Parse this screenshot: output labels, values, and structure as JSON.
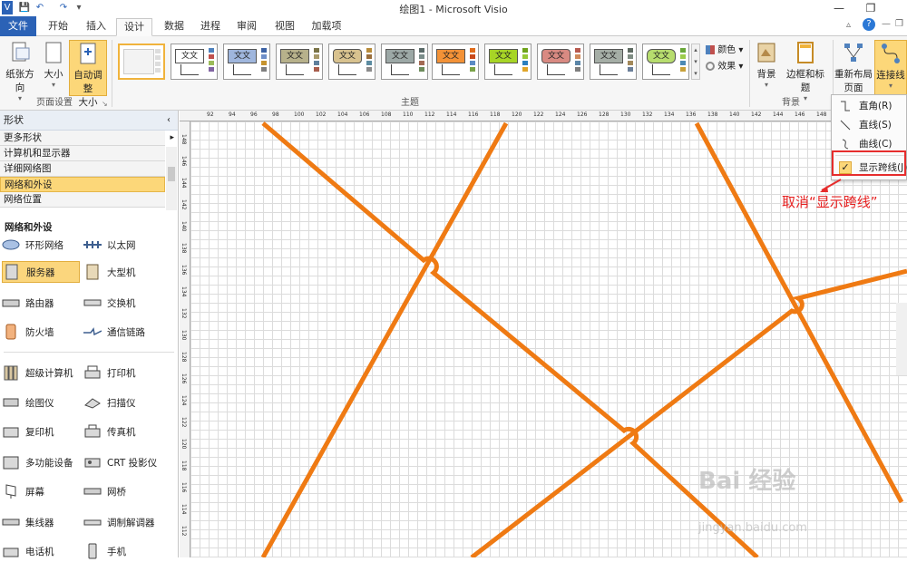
{
  "window": {
    "title": "绘图1 - Microsoft Visio",
    "quick_access": [
      "V",
      "💾",
      "↶",
      "↷",
      "▾"
    ]
  },
  "tabs": [
    "文件",
    "开始",
    "插入",
    "设计",
    "数据",
    "进程",
    "审阅",
    "视图",
    "加载项"
  ],
  "active_tab": "设计",
  "ribbon": {
    "page_setup": {
      "label": "页面设置",
      "buttons": [
        "纸张方向",
        "大小",
        "自动调整",
        "大小"
      ]
    },
    "themes": {
      "label": "主题",
      "tile_text": "文文",
      "colors_label": "颜色",
      "effects_label": "效果"
    },
    "background": {
      "label": "背景",
      "buttons": [
        "背景",
        "边框和标题"
      ]
    },
    "layout": {
      "relayout_label": "重新布局",
      "relayout_sub": "页面",
      "connector_label": "连接线"
    }
  },
  "connector_menu": {
    "items": [
      "直角(R)",
      "直线(S)",
      "曲线(C)",
      "显示跨线(J)"
    ],
    "checked_item": "显示跨线(J)"
  },
  "annotation": "取消“显示跨线”",
  "shapes_panel": {
    "header": "形状",
    "stencils": [
      "更多形状",
      "计算机和显示器",
      "详细网络图",
      "网络和外设",
      "网络位置"
    ],
    "selected_stencil": "网络和外设",
    "section_title": "网络和外设",
    "items": [
      "环形网络",
      "以太网",
      "服务器",
      "大型机",
      "路由器",
      "交换机",
      "防火墙",
      "通信链路",
      "超级计算机",
      "打印机",
      "绘图仪",
      "扫描仪",
      "复印机",
      "传真机",
      "多功能设备",
      "CRT 投影仪",
      "屏幕",
      "网桥",
      "集线器",
      "调制解调器",
      "电话机",
      "手机"
    ],
    "selected_item": "服务器"
  },
  "rulers": {
    "horizontal_ticks": [
      "92",
      "94",
      "96",
      "98",
      "100",
      "102",
      "104",
      "106",
      "108",
      "110",
      "112",
      "114",
      "116",
      "118",
      "120",
      "122",
      "124",
      "126",
      "128",
      "130",
      "132",
      "134",
      "136",
      "138",
      "140",
      "142",
      "144",
      "146",
      "148"
    ],
    "vertical_ticks": [
      "148",
      "146",
      "144",
      "142",
      "140",
      "138",
      "136",
      "134",
      "132",
      "130",
      "128",
      "126",
      "124",
      "122",
      "120",
      "118",
      "116",
      "114",
      "112"
    ]
  },
  "watermark": {
    "text": "Bai 经验",
    "url": "jingyan.baidu.com"
  },
  "colors": {
    "accent_orange": "#ef7a13",
    "file_tab": "#2b62b6",
    "selection_yellow": "#fcd779",
    "annotation_red": "#e62d2d"
  }
}
